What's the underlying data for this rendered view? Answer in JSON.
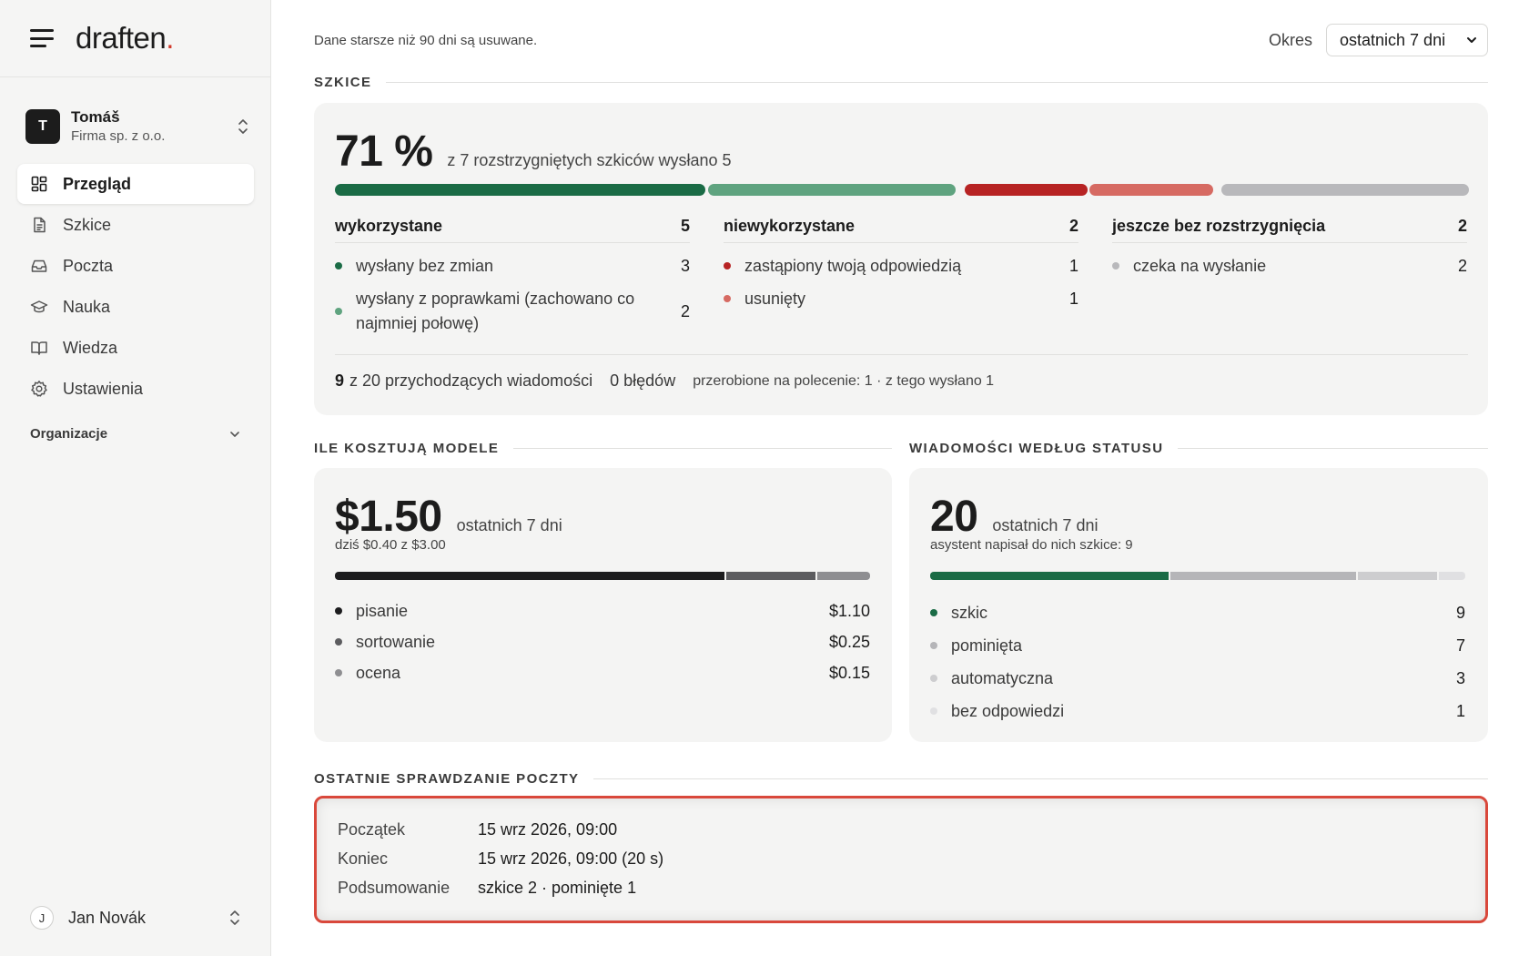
{
  "brand": {
    "name": "draften",
    "dot": "."
  },
  "account": {
    "initial": "T",
    "name": "Tomáš",
    "org": "Firma sp. z o.o."
  },
  "nav": [
    {
      "label": "Przegląd",
      "icon": "grid-icon",
      "active": true
    },
    {
      "label": "Szkice",
      "icon": "document-icon"
    },
    {
      "label": "Poczta",
      "icon": "inbox-icon"
    },
    {
      "label": "Nauka",
      "icon": "graduation-cap-icon"
    },
    {
      "label": "Wiedza",
      "icon": "book-icon"
    },
    {
      "label": "Ustawienia",
      "icon": "gear-icon"
    }
  ],
  "organizations_label": "Organizacje",
  "user": {
    "initial": "J",
    "name": "Jan Novák"
  },
  "header": {
    "retention_note": "Dane starsze niż 90 dni są usuwane.",
    "period_label": "Okres",
    "period_value": "ostatnich 7 dni"
  },
  "drafts": {
    "section_title": "SZKICE",
    "percent": "71 %",
    "summary": "z 7 rozstrzygniętych szkiców wysłano 5",
    "bar_colors": {
      "used_exact": "#1a6b45",
      "used_edited": "#5fa37f",
      "replaced": "#b72323",
      "deleted": "#d66a62",
      "pending": "#b8b8bb"
    },
    "used": {
      "title": "wykorzystane",
      "total": "5",
      "items": [
        {
          "label": "wysłany bez zmian",
          "value": "3"
        },
        {
          "label": "wysłany z poprawkami (zachowano co najmniej połowę)",
          "value": "2"
        }
      ]
    },
    "unused": {
      "title": "niewykorzystane",
      "total": "2",
      "items": [
        {
          "label": "zastąpiony twoją odpowiedzią",
          "value": "1"
        },
        {
          "label": "usunięty",
          "value": "1"
        }
      ]
    },
    "pending": {
      "title": "jeszcze bez rozstrzygnięcia",
      "total": "2",
      "items": [
        {
          "label": "czeka na wysłanie",
          "value": "2"
        }
      ]
    },
    "footer": {
      "incoming_count": "9",
      "incoming_text": "z 20 przychodzących wiadomości",
      "errors": "0 błędów",
      "rework": "przerobione na polecenie: 1 · z tego wysłano 1"
    }
  },
  "costs": {
    "section_title": "ILE KOSZTUJĄ MODELE",
    "total": "$1.50",
    "period": "ostatnich 7 dni",
    "today": "dziś $0.40 z $3.00",
    "items": [
      {
        "label": "pisanie",
        "value": "$1.10",
        "share": 1.1,
        "color": "#1c1c1e"
      },
      {
        "label": "sortowanie",
        "value": "$0.25",
        "share": 0.25,
        "color": "#5c5c5f"
      },
      {
        "label": "ocena",
        "value": "$0.15",
        "share": 0.15,
        "color": "#8e8e91"
      }
    ]
  },
  "messages": {
    "section_title": "WIADOMOŚCI WEDŁUG STATUSU",
    "total": "20",
    "period": "ostatnich 7 dni",
    "note": "asystent napisał do nich szkice: 9",
    "items": [
      {
        "label": "szkic",
        "value": "9",
        "count": 9,
        "color": "#1a6b45"
      },
      {
        "label": "pominięta",
        "value": "7",
        "count": 7,
        "color": "#b5b5b8"
      },
      {
        "label": "automatyczna",
        "value": "3",
        "count": 3,
        "color": "#cdcdcf"
      },
      {
        "label": "bez odpowiedzi",
        "value": "1",
        "count": 1,
        "color": "#e0e0e2"
      }
    ]
  },
  "last_check": {
    "section_title": "OSTATNIE SPRAWDZANIE POCZTY",
    "rows": [
      {
        "key": "Początek",
        "value": "15 wrz 2026, 09:00"
      },
      {
        "key": "Koniec",
        "value": "15 wrz 2026, 09:00 (20 s)"
      },
      {
        "key": "Podsumowanie",
        "value": "szkice 2 · pominięte 1"
      }
    ]
  }
}
